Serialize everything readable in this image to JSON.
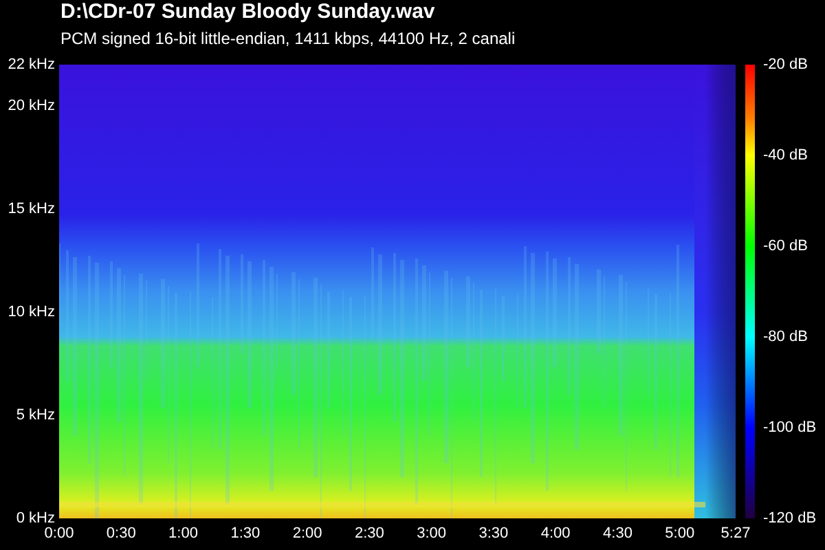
{
  "title": "D:\\CDr-07 Sunday Bloody Sunday.wav",
  "subtitle": "PCM signed 16-bit little-endian, 1411 kbps, 44100 Hz, 2 canali",
  "y_axis": [
    "22 kHz",
    "20 kHz",
    "15 kHz",
    "10 kHz",
    "5 kHz",
    "0 kHz"
  ],
  "x_axis": [
    "0:00",
    "0:30",
    "1:00",
    "1:30",
    "2:00",
    "2:30",
    "3:00",
    "3:30",
    "4:00",
    "4:30",
    "5:00",
    "5:27"
  ],
  "colorbar": [
    "-20 dB",
    "-40 dB",
    "-60 dB",
    "-80 dB",
    "-100 dB",
    "-120 dB"
  ]
}
